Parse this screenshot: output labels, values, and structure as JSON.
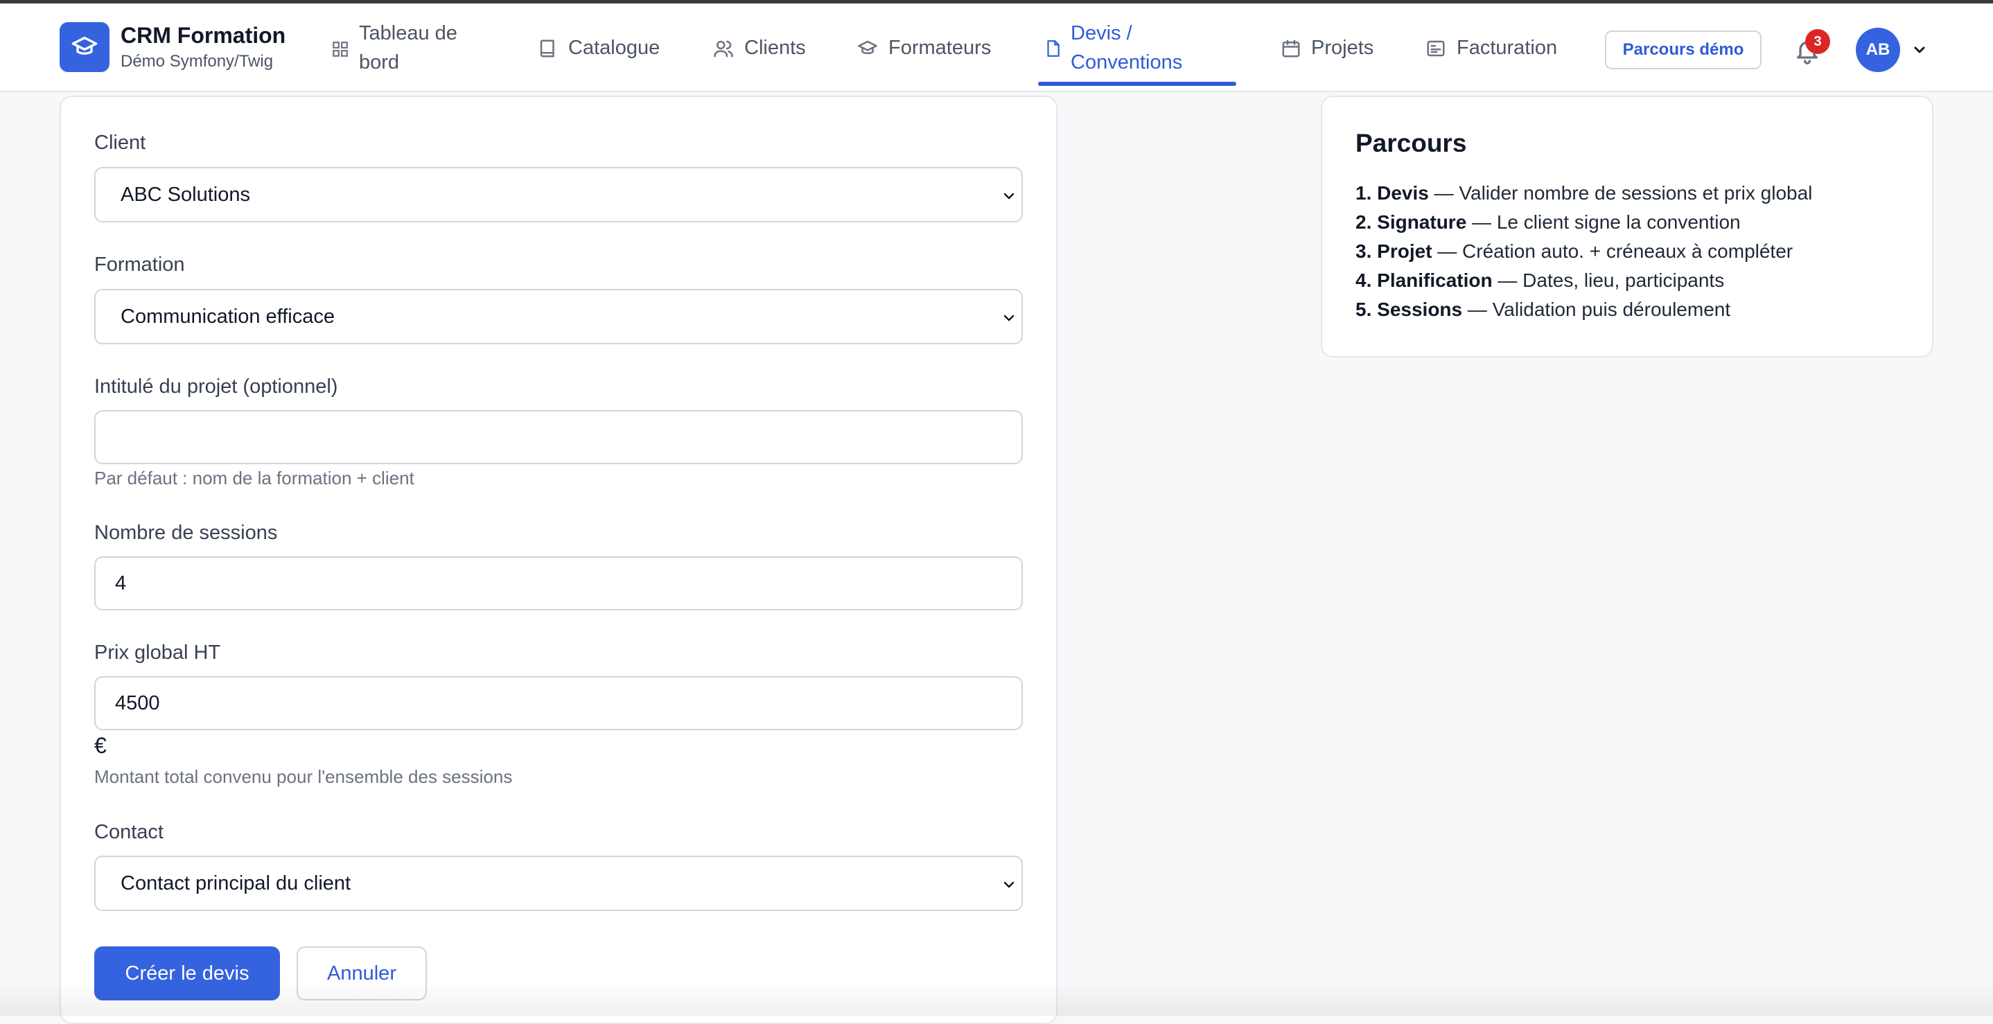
{
  "brand": {
    "title": "CRM Formation",
    "subtitle": "Démo Symfony/Twig",
    "logo_icon": "graduation-cap-icon"
  },
  "nav": {
    "items": [
      {
        "label_line1": "Tableau de",
        "label_line2": "bord",
        "icon": "grid-icon"
      },
      {
        "label": "Catalogue",
        "icon": "book-icon"
      },
      {
        "label": "Clients",
        "icon": "users-icon"
      },
      {
        "label": "Formateurs",
        "icon": "graduation-cap-icon"
      },
      {
        "label_line1": "Devis /",
        "label_line2": "Conventions",
        "icon": "document-icon",
        "active": true
      },
      {
        "label": "Projets",
        "icon": "calendar-icon"
      },
      {
        "label": "Facturation",
        "icon": "invoice-icon"
      }
    ],
    "demo_button": "Parcours démo",
    "notifications_count": "3",
    "avatar_initials": "AB"
  },
  "form": {
    "client": {
      "label": "Client",
      "value": "ABC Solutions"
    },
    "formation": {
      "label": "Formation",
      "value": "Communication efficace"
    },
    "project_title": {
      "label": "Intitulé du projet (optionnel)",
      "value": "",
      "help": "Par défaut : nom de la formation + client"
    },
    "sessions": {
      "label": "Nombre de sessions",
      "value": "4"
    },
    "price": {
      "label": "Prix global HT",
      "value": "4500",
      "currency": "€",
      "help": "Montant total convenu pour l'ensemble des sessions"
    },
    "contact": {
      "label": "Contact",
      "value": "Contact principal du client"
    },
    "submit_label": "Créer le devis",
    "cancel_label": "Annuler"
  },
  "parcours": {
    "title": "Parcours",
    "steps": [
      {
        "num": "1.",
        "name": "Devis",
        "desc": " — Valider nombre de sessions et prix global"
      },
      {
        "num": "2.",
        "name": "Signature",
        "desc": " — Le client signe la convention"
      },
      {
        "num": "3.",
        "name": "Projet",
        "desc": " — Création auto. + créneaux à compléter"
      },
      {
        "num": "4.",
        "name": "Planification",
        "desc": " — Dates, lieu, participants"
      },
      {
        "num": "5.",
        "name": "Sessions",
        "desc": " — Validation puis déroulement"
      }
    ]
  },
  "colors": {
    "accent": "#3563e0",
    "active_nav": "#2f5bd8",
    "badge": "#dc2626",
    "background": "#f7f8fa"
  }
}
